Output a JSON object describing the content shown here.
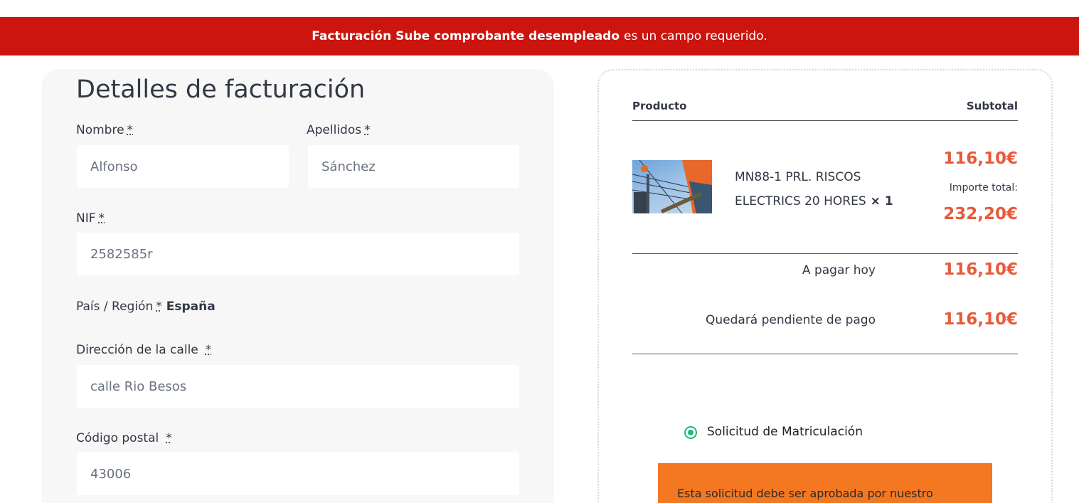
{
  "error": {
    "field": "Facturación Sube comprobante desempleado",
    "message": "es un campo requerido."
  },
  "billing": {
    "title": "Detalles de facturación",
    "required_mark": "*",
    "fields": {
      "nombre": {
        "label": "Nombre",
        "value": "Alfonso"
      },
      "apellidos": {
        "label": "Apellidos",
        "value": "Sánchez"
      },
      "nif": {
        "label": "NIF",
        "value": "2582585r"
      },
      "pais": {
        "label": "País / Región",
        "value": "España"
      },
      "direccion": {
        "label": "Dirección de la calle",
        "value": "calle Rio Besos"
      },
      "codigo_postal": {
        "label": "Código postal",
        "value": "43006"
      }
    }
  },
  "order": {
    "col_product": "Producto",
    "col_subtotal": "Subtotal",
    "item": {
      "name": "MN88-1 PRL. RISCOS ELECTRICS 20 HORES",
      "qty": "× 1",
      "price": "116,10€",
      "total_label": "Importe total:",
      "total": "232,20€"
    },
    "pay_today_label": "A pagar hoy",
    "pay_today": "116,10€",
    "pending_label": "Quedará pendiente de pago",
    "pending": "116,10€"
  },
  "payment": {
    "option_label": "Solicitud de Matriculación",
    "notice": "Esta solicitud debe ser aprobada por nuestro"
  },
  "colors": {
    "error_bg": "#cc150f",
    "price": "#e8593a",
    "radio": "#1fb97a",
    "notice_bg": "#f47822"
  }
}
